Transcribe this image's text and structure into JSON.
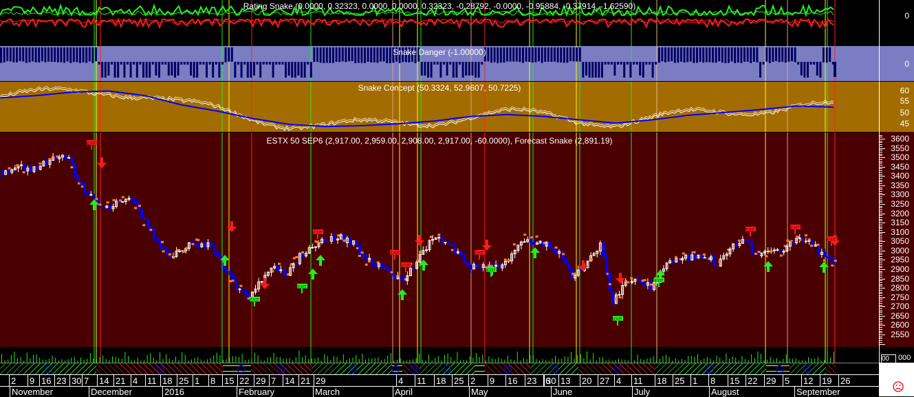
{
  "panels": {
    "rating": {
      "title": "Rating Snake (0.0000, 0.32323, 0.0000, 0.0000, 0.32323, -0.28792, -0.0000, -0.95884, -0.37914, -1.62590)",
      "axis_label": "0"
    },
    "danger": {
      "title": "Snake Danger (-1.00000)",
      "axis_label": "0"
    },
    "concept": {
      "title": "Snake Concept (50.3324, 52.9607, 50.7225)",
      "axis_labels": [
        "60",
        "55",
        "50",
        "45"
      ]
    },
    "price": {
      "title": "ESTX 50 SEP6 (2,917.00, 2,959.00, 2,908.00, 2,917.00, -60.0000), Forecast Snake (2,891.19)",
      "exit_label": "EXIT"
    },
    "volume": {
      "box_value": "00",
      "axis_value": "000"
    }
  },
  "colors": {
    "rating_bg": "#000000",
    "danger_bg": "#7b7dc3",
    "concept_bg": "#a36c00",
    "price_bg": "#4a0000",
    "up": "#ffffff",
    "down": "#0000ff",
    "buy": "#22ee22",
    "sell": "#ff1a1a"
  },
  "date_axis": {
    "days": [
      "2",
      "9",
      "16",
      "23",
      "30",
      "7",
      "14",
      "21",
      "4",
      "11",
      "18",
      "25",
      "1",
      "8",
      "15",
      "22",
      "29",
      "7",
      "14",
      "21",
      "29",
      "4",
      "11",
      "18",
      "25",
      "2",
      "9",
      "16",
      "23",
      "30",
      "6",
      "13",
      "20",
      "27",
      "4",
      "11",
      "18",
      "25",
      "1",
      "8",
      "15",
      "22",
      "29",
      "5",
      "12",
      "19",
      "26"
    ],
    "months": [
      "November",
      "December",
      "2016",
      "February",
      "March",
      "April",
      "May",
      "June",
      "July",
      "August",
      "September"
    ]
  },
  "status_icon": "sad-face-icon",
  "chart_data": {
    "type": "candlestick",
    "title": "ESTX 50 SEP6",
    "ylim": [
      2500,
      3620
    ],
    "yticks": [
      3600,
      3550,
      3500,
      3450,
      3400,
      3350,
      3300,
      3250,
      3200,
      3150,
      3100,
      3050,
      3000,
      2950,
      2900,
      2850,
      2800,
      2750,
      2700,
      2650,
      2600,
      2550
    ],
    "approx_close_series": [
      3423,
      3452,
      3440,
      3460,
      3490,
      3515,
      3368,
      3276,
      3220,
      3276,
      3294,
      3165,
      3055,
      2963,
      3018,
      3036,
      3036,
      2926,
      2815,
      2741,
      2852,
      2907,
      2889,
      2981,
      3036,
      3055,
      3073,
      3047,
      2952,
      2926,
      2870,
      2852,
      2963,
      3062,
      3062,
      3000,
      2907,
      2926,
      2926,
      2944,
      3073,
      3055,
      3036,
      2981,
      2852,
      2944,
      3036,
      2723,
      2834,
      2852,
      2797,
      2926,
      2963,
      2970,
      2989,
      2926,
      3018,
      3055,
      2989,
      3000,
      3000,
      3073,
      3073,
      2981,
      2917
    ],
    "last": {
      "open": 2917.0,
      "high": 2959.0,
      "low": 2908.0,
      "close": 2917.0,
      "change": -60.0,
      "forecast_snake": 2891.19
    },
    "snake_concept": {
      "ylim": [
        42,
        64
      ],
      "blue_line": [
        57,
        58,
        59.5,
        60,
        58,
        54,
        51.3,
        48,
        45.5,
        44.6,
        45,
        45.8,
        47,
        49,
        49.8,
        49,
        47.5,
        46.1,
        47.5,
        49.5,
        50.7,
        52,
        53.5,
        53
      ],
      "white_line_last": 50.7225
    },
    "snake_danger_last": -1.0,
    "rating_snake_last": -1.6259
  }
}
